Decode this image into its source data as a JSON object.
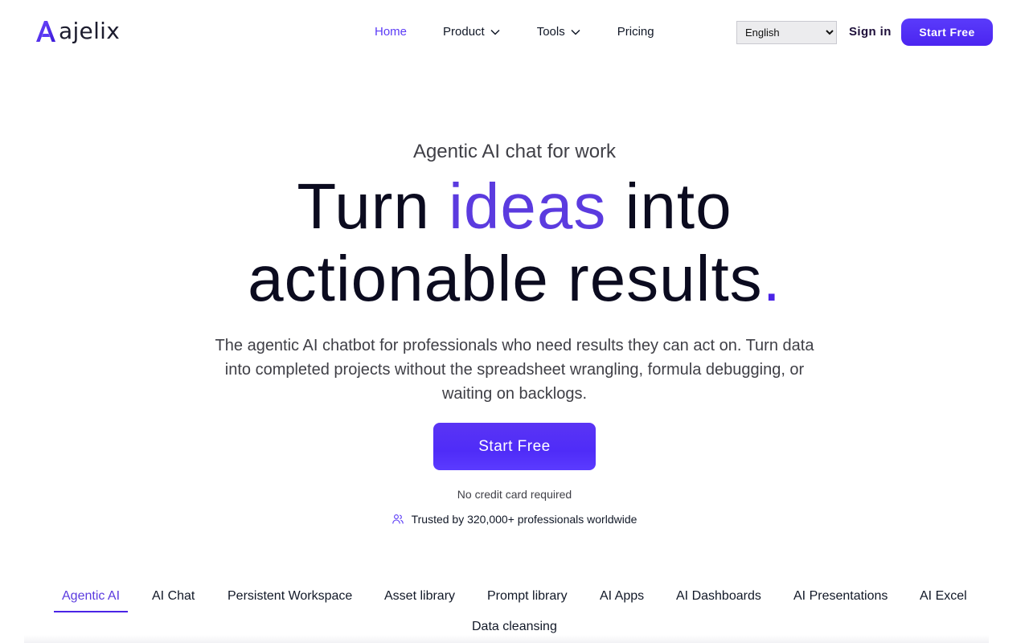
{
  "brand": {
    "name": "ajelix",
    "logo_icon": "ajelix-a-logo-icon",
    "accent_color": "#5b3bf6"
  },
  "nav": {
    "items": [
      {
        "label": "Home",
        "active": true,
        "has_dropdown": false
      },
      {
        "label": "Product",
        "active": false,
        "has_dropdown": true
      },
      {
        "label": "Tools",
        "active": false,
        "has_dropdown": true
      },
      {
        "label": "Pricing",
        "active": false,
        "has_dropdown": false
      }
    ],
    "dropdown_icon": "chevron-down-icon"
  },
  "language": {
    "selected": "English"
  },
  "auth": {
    "signin_label": "Sign in",
    "start_free_label": "Start Free"
  },
  "hero": {
    "eyebrow": "Agentic AI chat for work",
    "headline_part1": "Turn",
    "headline_accent": "ideas",
    "headline_part2": "into",
    "headline_line2": "actionable results",
    "headline_dot": ".",
    "subtitle": "The agentic AI chatbot for professionals who need results they can act on. Turn data into completed projects without the spreadsheet wrangling, formula debugging, or waiting on backlogs.",
    "cta_label": "Start Free",
    "no_card_text": "No credit card required",
    "trusted_icon": "users-icon",
    "trusted_text": "Trusted by 320,000+ professionals worldwide"
  },
  "feature_tabs": {
    "items": [
      {
        "label": "Agentic AI",
        "active": true
      },
      {
        "label": "AI Chat",
        "active": false
      },
      {
        "label": "Persistent Workspace",
        "active": false
      },
      {
        "label": "Asset library",
        "active": false
      },
      {
        "label": "Prompt library",
        "active": false
      },
      {
        "label": "AI Apps",
        "active": false
      },
      {
        "label": "AI Dashboards",
        "active": false
      },
      {
        "label": "AI Presentations",
        "active": false
      },
      {
        "label": "AI Excel",
        "active": false
      },
      {
        "label": "Data cleansing",
        "active": false
      }
    ]
  }
}
